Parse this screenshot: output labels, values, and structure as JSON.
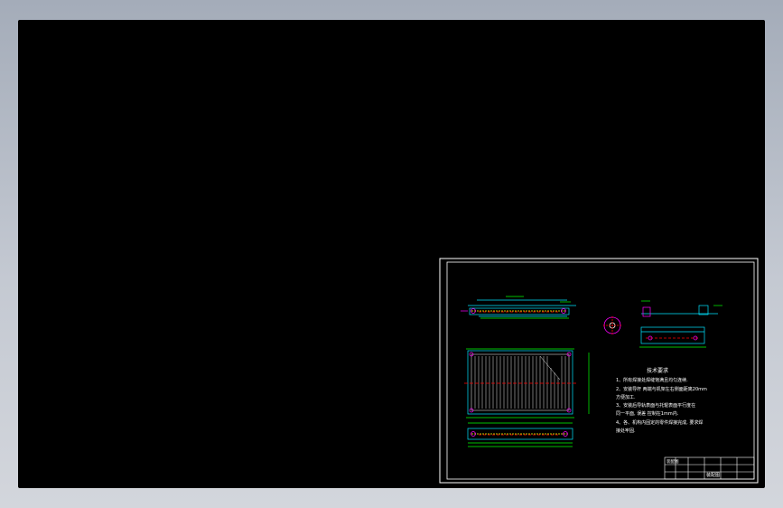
{
  "viewer": {
    "background_color": "#000000",
    "frame_color": "#b3b9c4"
  },
  "drawing": {
    "colors": {
      "frame": "#ffffff",
      "cyan": "#00e5ff",
      "green": "#00ff00",
      "magenta": "#ff00ff",
      "red": "#ff0000",
      "yellow": "#ffff00"
    },
    "technical_requirements": {
      "title": "技术要求",
      "lines": [
        "1、所有焊接处焊缝饱满且均匀连续.",
        "2、安装导杆 两端与机架左右侧面距离20mm",
        "方便加工.",
        "3、安装后导轨表面与托辊表面平行度在",
        "同一平面, 误差 控制在1mm内.",
        "4、各、机构内固定的零件焊接完成, 要求焊",
        "接处牢固."
      ]
    },
    "title_block": {
      "cells": [
        "装配图",
        "",
        "",
        "",
        "",
        "",
        "",
        "",
        "装配图"
      ]
    }
  }
}
